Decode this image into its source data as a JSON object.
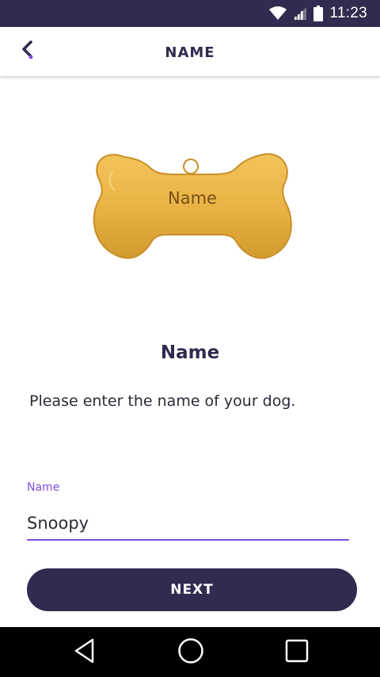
{
  "status_bar": {
    "time": "11:23",
    "icons": [
      "wifi-icon",
      "signal-icon",
      "battery-icon"
    ],
    "background": "#322b4f"
  },
  "app_bar": {
    "title": "NAME",
    "back_icon": "chevron-left-icon",
    "accent": "#7b4fe0"
  },
  "tag": {
    "engraving": "Name",
    "color": "#e8b143"
  },
  "content": {
    "heading": "Name",
    "description": "Please enter the name of your dog."
  },
  "form": {
    "name_label": "Name",
    "name_value": "Snoopy",
    "underline_color": "#7b4fe0"
  },
  "actions": {
    "next_label": "NEXT",
    "button_color": "#322b4f"
  },
  "nav_bar": {
    "icons": [
      "back-triangle-icon",
      "home-circle-icon",
      "recents-square-icon"
    ]
  }
}
